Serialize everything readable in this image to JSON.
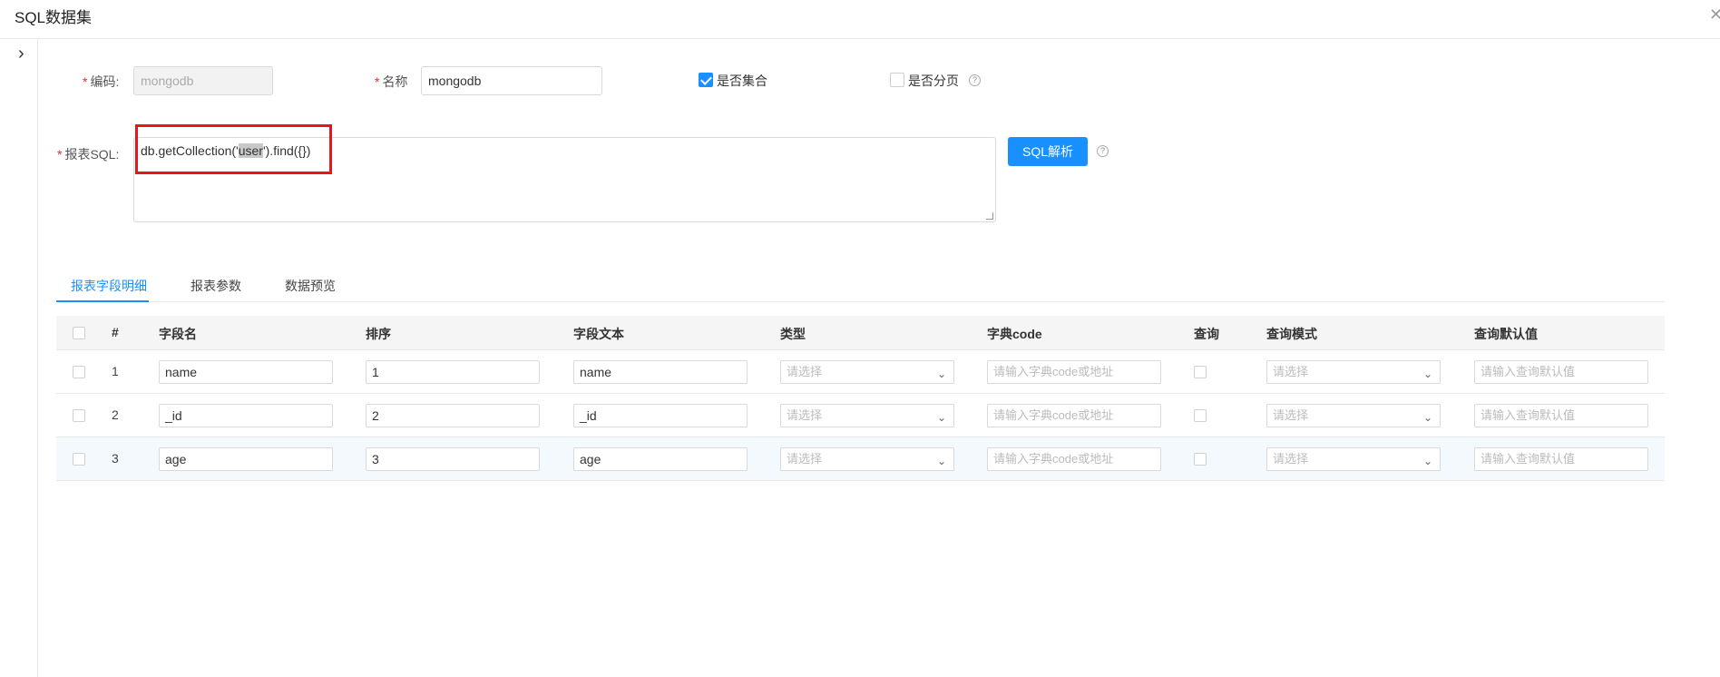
{
  "window": {
    "title": "SQL数据集",
    "close_icon": "close-icon"
  },
  "sidebar": {
    "toggle_icon": "chevron-right-icon"
  },
  "form": {
    "code_label": "编码:",
    "code_value": "mongodb",
    "name_label": "名称",
    "name_value": "mongodb",
    "is_collection_label": "是否集合",
    "is_collection_checked": true,
    "is_paged_label": "是否分页",
    "is_paged_checked": false,
    "sql_label": "报表SQL:",
    "sql_pre": "db.getCollection('",
    "sql_highlight": "user",
    "sql_post": "').find({})",
    "parse_button": "SQL解析",
    "required_mark": "*"
  },
  "tabs": [
    {
      "label": "报表字段明细",
      "active": true
    },
    {
      "label": "报表参数",
      "active": false
    },
    {
      "label": "数据预览",
      "active": false
    }
  ],
  "table": {
    "headers": {
      "index": "#",
      "field_name": "字段名",
      "order": "排序",
      "field_text": "字段文本",
      "type": "类型",
      "dict_code": "字典code",
      "query": "查询",
      "query_mode": "查询模式",
      "query_default": "查询默认值"
    },
    "placeholders": {
      "type": "请选择",
      "dict_code": "请输入字典code或地址",
      "query_mode": "请选择",
      "query_default": "请输入查询默认值"
    },
    "rows": [
      {
        "index": "1",
        "field_name": "name",
        "order": "1",
        "field_text": "name"
      },
      {
        "index": "2",
        "field_name": "_id",
        "order": "2",
        "field_text": "_id"
      },
      {
        "index": "3",
        "field_name": "age",
        "order": "3",
        "field_text": "age"
      }
    ]
  },
  "colors": {
    "accent": "#1890ff",
    "required": "#f5222d",
    "highlight_box": "#e8161b",
    "row_highlight": "#f4f9fd"
  }
}
